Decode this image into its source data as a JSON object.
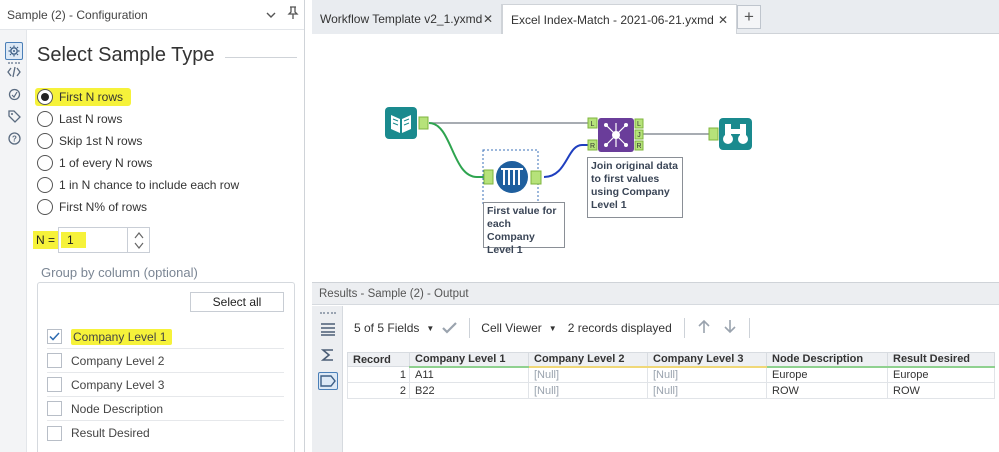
{
  "config_pane": {
    "header_title": "Sample (2) - Configuration",
    "heading": "Select Sample Type",
    "options": [
      {
        "label": "First N rows",
        "checked": true,
        "highlighted": true
      },
      {
        "label": "Last N rows",
        "checked": false
      },
      {
        "label": "Skip 1st N rows",
        "checked": false
      },
      {
        "label": "1 of every N rows",
        "checked": false
      },
      {
        "label": "1 in N chance to include each row",
        "checked": false
      },
      {
        "label": "First N% of rows",
        "checked": false
      }
    ],
    "n_label": "N =",
    "n_value": "1",
    "group_by_label": "Group by column (optional)",
    "select_all_label": "Select all",
    "columns": [
      {
        "label": "Company Level 1",
        "checked": true,
        "highlighted": true
      },
      {
        "label": "Company Level 2",
        "checked": false
      },
      {
        "label": "Company Level 3",
        "checked": false
      },
      {
        "label": "Node Description",
        "checked": false
      },
      {
        "label": "Result Desired",
        "checked": false
      }
    ]
  },
  "tabs": [
    {
      "label": "Workflow Template v2_1.yxmd",
      "active": false
    },
    {
      "label": "Excel Index-Match - 2021-06-21.yxmd",
      "active": true
    }
  ],
  "canvas": {
    "sample_tool_label": [
      "First value for",
      "each Company",
      "Level 1"
    ],
    "join_tool_label": [
      "Join original data",
      "to first values",
      "using Company",
      "Level 1"
    ],
    "join_anchor_in_left": "L",
    "join_anchor_in_right": "R",
    "join_anchor_out_left": "L",
    "join_anchor_out_join": "J",
    "join_anchor_out_right": "R"
  },
  "results": {
    "header": "Results - Sample (2) - Output",
    "fields_label": "5 of 5 Fields",
    "viewer_label": "Cell Viewer",
    "records_label": "2 records displayed",
    "columns": [
      "Record",
      "Company Level 1",
      "Company Level 2",
      "Company Level 3",
      "Node Description",
      "Result Desired"
    ],
    "rows": [
      [
        "1",
        "A11",
        "[Null]",
        "[Null]",
        "Europe",
        "Europe"
      ],
      [
        "2",
        "B22",
        "[Null]",
        "[Null]",
        "ROW",
        "ROW"
      ]
    ]
  },
  "colors": {
    "highlight": "#f6f23a",
    "tool_teal": "#1a8a8e",
    "tool_blue": "#1f5f9e",
    "tool_purple": "#6a3d9a",
    "connector_green": "#2ea44f",
    "connector_blue": "#1f3fbf"
  }
}
